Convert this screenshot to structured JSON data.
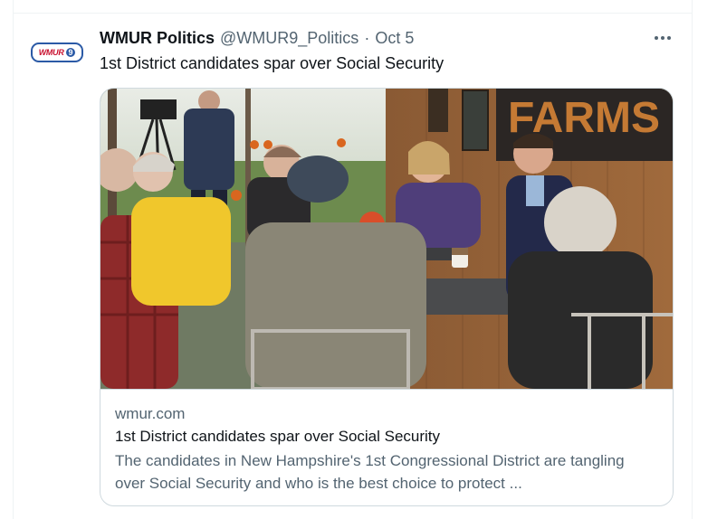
{
  "tweet": {
    "author_name": "WMUR Politics",
    "author_handle": "@WMUR9_Politics",
    "separator": "·",
    "date": "Oct 5",
    "text": "1st District candidates spar over Social Security",
    "avatar_logo_text": "WMUR",
    "avatar_logo_badge": "9"
  },
  "card": {
    "domain": "wmur.com",
    "title": "1st District candidates spar over Social Security",
    "description": "The candidates in New Hampshire's 1st Congressional District are tangling over Social Security and who is the best choice to protect ...",
    "sign_text": "FARMS"
  },
  "icons": {
    "more": "more-horizontal-icon"
  },
  "colors": {
    "text_primary": "#0f1419",
    "text_secondary": "#536471",
    "border": "#cfd9de"
  }
}
